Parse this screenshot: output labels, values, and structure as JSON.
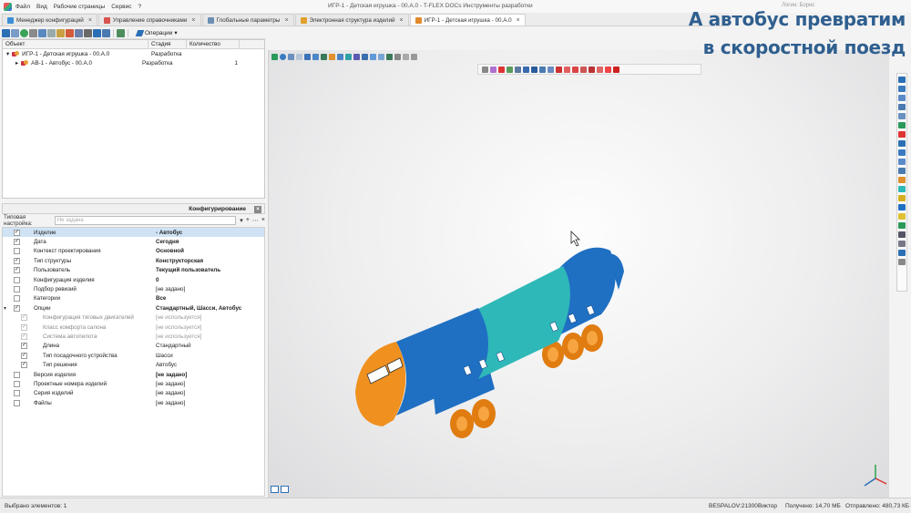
{
  "app": {
    "window_title": "ИГР-1 - Детская игрушка - 00.А.0 - T-FLEX DOCs Инструменты разработки",
    "login": "Логин: Борис",
    "menu": [
      "Файл",
      "Вид",
      "Рабочие страницы",
      "Сервис",
      "?"
    ]
  },
  "tabs": [
    {
      "label": "Менеджер конфигураций",
      "close": "×"
    },
    {
      "label": "Управление справочниками",
      "close": "×"
    },
    {
      "label": "Глобальные параметры",
      "close": "×"
    },
    {
      "label": "Электронная структура изделий",
      "close": "×"
    },
    {
      "label": "ИГР-1 - Детская игрушка - 00.А.0",
      "close": "×"
    }
  ],
  "toolbar": {
    "operations_label": "Операции",
    "operations_caret": "▾"
  },
  "tree": {
    "columns": [
      "Объект",
      "Стадия",
      "Количество"
    ],
    "rows": [
      {
        "expander": "▾",
        "name": "ИГР-1 - Детская игрушка - 00.А.0",
        "stage": "Разработка",
        "qty": ""
      },
      {
        "expander": "▸",
        "name": "АВ-1 - Автобус - 00.А.0",
        "stage": "Разработка",
        "qty": "1"
      }
    ]
  },
  "config": {
    "title": "Конфигурирование",
    "close": "×",
    "typical_label": "Типовая настройка:",
    "typical_placeholder": "Не задана",
    "typical_controls": [
      "▾",
      "+",
      "⋯",
      "×"
    ],
    "properties": [
      {
        "name": "Изделие",
        "value": "- Автобус",
        "checked": "✓",
        "indent": 0,
        "bold": true,
        "selected": true
      },
      {
        "name": "Дата",
        "value": "Сегодня",
        "checked": "✓",
        "indent": 0,
        "bold": true
      },
      {
        "name": "Контекст проектирования",
        "value": "Основной",
        "checked": "",
        "indent": 0,
        "bold": true
      },
      {
        "name": "Тип структуры",
        "value": "Конструкторская",
        "checked": "✓",
        "indent": 0,
        "bold": true
      },
      {
        "name": "Пользователь",
        "value": "Текущий пользователь",
        "checked": "✓",
        "indent": 0,
        "bold": true
      },
      {
        "name": "Конфигурация изделия",
        "value": "0",
        "checked": "",
        "indent": 0,
        "bold": true
      },
      {
        "name": "Подбор ревизий",
        "value": "[не задано]",
        "checked": "",
        "indent": 0
      },
      {
        "name": "Категории",
        "value": "Все",
        "checked": "",
        "indent": 0,
        "bold": true
      },
      {
        "name": "Опции",
        "value": "Стандартный, Шасси, Автобус",
        "checked": "✓",
        "indent": 0,
        "bold": true,
        "expander": "▾"
      },
      {
        "name": "Конфигурация тяговых двигателей",
        "value": "[не используется]",
        "checked": "✓",
        "indent": 1,
        "dim": true
      },
      {
        "name": "Класс комфорта салона",
        "value": "[не используется]",
        "checked": "✓",
        "indent": 1,
        "dim": true
      },
      {
        "name": "Система автопилота",
        "value": "[не используется]",
        "checked": "✓",
        "indent": 1,
        "dim": true
      },
      {
        "name": "Длина",
        "value": "Стандартный",
        "checked": "✓",
        "indent": 1
      },
      {
        "name": "Тип посадочного устройства",
        "value": "Шасси",
        "checked": "✓",
        "indent": 1
      },
      {
        "name": "Тип решения",
        "value": "Автобус",
        "checked": "✓",
        "indent": 1
      },
      {
        "name": "Версия изделия",
        "value": "[не задано]",
        "checked": "",
        "indent": 0,
        "bold": true
      },
      {
        "name": "Проектные номера изделий",
        "value": "[не задано]",
        "checked": "",
        "indent": 0
      },
      {
        "name": "Серия изделий",
        "value": "[не задано]",
        "checked": "",
        "indent": 0
      },
      {
        "name": "Файлы",
        "value": "[не задано]",
        "checked": "",
        "indent": 0
      }
    ]
  },
  "overlay": {
    "line1": "А автобус превратим",
    "line2": "в скоростной поезд"
  },
  "status": {
    "selected": "Выбрано элементов: 1",
    "user_host": "BESPALOV:21300",
    "user": "Виктор",
    "received": "Получено: 14,70 МБ",
    "sent": "Отправлено: 480,73 КБ"
  },
  "colors": {
    "accent": "#2b6fb5",
    "overlay_text": "#2f5f8f",
    "model_blue": "#1f6fc2",
    "model_teal": "#2fb8b8",
    "model_orange": "#f0901e"
  }
}
